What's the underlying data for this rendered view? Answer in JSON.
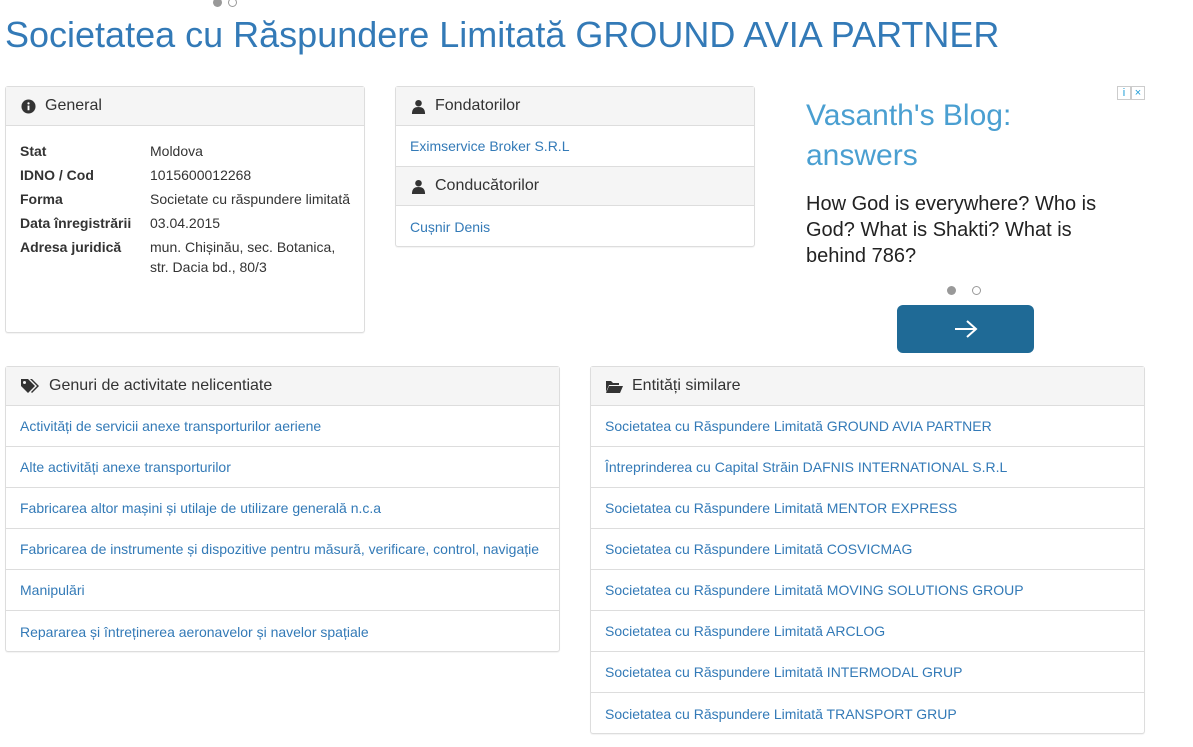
{
  "page_title": "Societatea cu Răspundere Limitată GROUND AVIA PARTNER",
  "general": {
    "heading": "General",
    "rows": [
      {
        "label": "Stat",
        "value": "Moldova"
      },
      {
        "label": "IDNO / Cod",
        "value": "1015600012268"
      },
      {
        "label": "Forma",
        "value": "Societate cu răspundere limitată"
      },
      {
        "label": "Data înregistrării",
        "value": "03.04.2015"
      },
      {
        "label": "Adresa juridică",
        "value": "mun. Chișinău, sec. Botanica, str. Dacia bd., 80/3"
      }
    ]
  },
  "founders": {
    "heading": "Fondatorilor",
    "items": [
      "Eximservice Broker S.R.L"
    ]
  },
  "managers": {
    "heading": "Conducătorilor",
    "items": [
      "Cușnir Denis"
    ]
  },
  "ad": {
    "headline": "Vasanth's Blog: answers",
    "text": "How God is everywhere? Who is God? What is Shakti? What is behind 786?",
    "adchoices": [
      "i",
      "×"
    ],
    "button_icon": "arrow-right-icon"
  },
  "activities": {
    "heading": "Genuri de activitate nelicentiate",
    "items": [
      "Activități de servicii anexe transporturilor aeriene",
      "Alte activități anexe transporturilor",
      "Fabricarea altor mașini și utilaje de utilizare generală n.c.a",
      "Fabricarea de instrumente și dispozitive pentru măsură, verificare, control, navigație",
      "Manipulări",
      "Repararea și întreținerea aeronavelor și navelor spațiale"
    ]
  },
  "similar": {
    "heading": "Entități similare",
    "items": [
      "Societatea cu Răspundere Limitată GROUND AVIA PARTNER",
      "Întreprinderea cu Capital Străin DAFNIS INTERNATIONAL S.R.L",
      "Societatea cu Răspundere Limitată MENTOR EXPRESS",
      "Societatea cu Răspundere Limitată COSVICMAG",
      "Societatea cu Răspundere Limitată MOVING SOLUTIONS GROUP",
      "Societatea cu Răspundere Limitată ARCLOG",
      "Societatea cu Răspundere Limitată INTERMODAL GRUP",
      "Societatea cu Răspundere Limitată TRANSPORT GRUP"
    ]
  },
  "colors": {
    "link": "#337ab7",
    "title": "#337ab7",
    "ad_button": "#1f6a96",
    "ad_headline": "#4a9fd1"
  }
}
